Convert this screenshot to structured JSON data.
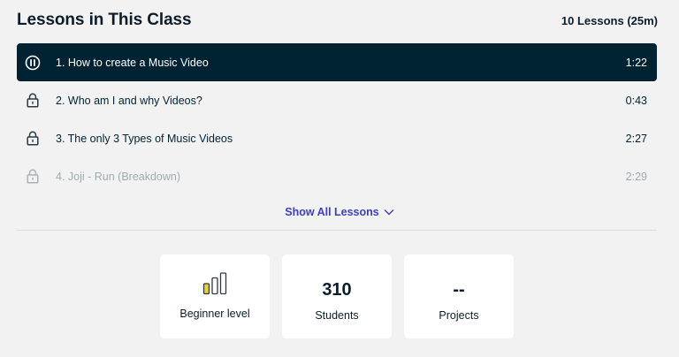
{
  "header": {
    "title": "Lessons in This Class",
    "count": "10 Lessons (25m)"
  },
  "lessons": [
    {
      "label": "1. How to create a Music Video",
      "time": "1:22",
      "state": "playing",
      "icon": "pause-icon"
    },
    {
      "label": "2. Who am I and why Videos?",
      "time": "0:43",
      "state": "locked",
      "icon": "lock-icon"
    },
    {
      "label": "3. The only 3 Types of Music Videos",
      "time": "2:27",
      "state": "locked",
      "icon": "lock-icon"
    },
    {
      "label": "4. Joji - Run (Breakdown)",
      "time": "2:29",
      "state": "locked-faded",
      "icon": "lock-icon"
    }
  ],
  "show_all": {
    "label": "Show All Lessons",
    "icon": "chevron-down-icon"
  },
  "stats": {
    "level": {
      "label": "Beginner level",
      "icon": "level-bars-icon",
      "level_filled": 1,
      "level_total": 3
    },
    "students": {
      "value": "310",
      "label": "Students"
    },
    "projects": {
      "value": "--",
      "label": "Projects"
    }
  },
  "colors": {
    "active_row_bg": "#002333",
    "accent_link": "#3d3fc4",
    "level_fill": "#f0d21e",
    "page_bg": "#f2f2f2"
  }
}
